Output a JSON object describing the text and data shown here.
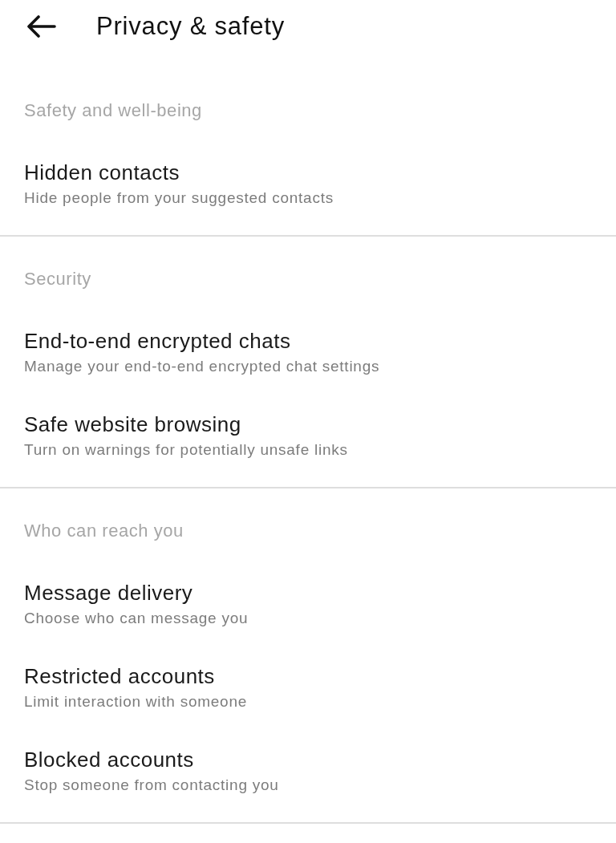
{
  "header": {
    "title": "Privacy & safety"
  },
  "sections": [
    {
      "label": "Safety and well-being",
      "items": [
        {
          "title": "Hidden contacts",
          "subtitle": "Hide people from your suggested contacts"
        }
      ]
    },
    {
      "label": "Security",
      "items": [
        {
          "title": "End-to-end encrypted chats",
          "subtitle": "Manage your end-to-end encrypted chat settings"
        },
        {
          "title": "Safe website browsing",
          "subtitle": "Turn on warnings for potentially unsafe links"
        }
      ]
    },
    {
      "label": "Who can reach you",
      "items": [
        {
          "title": "Message delivery",
          "subtitle": "Choose who can message you"
        },
        {
          "title": "Restricted accounts",
          "subtitle": "Limit interaction with someone"
        },
        {
          "title": "Blocked accounts",
          "subtitle": "Stop someone from contacting you"
        }
      ]
    }
  ]
}
